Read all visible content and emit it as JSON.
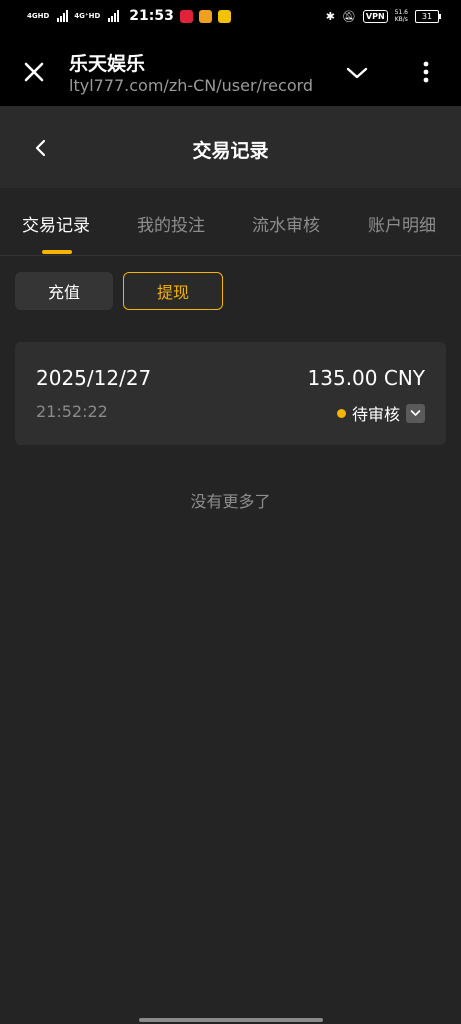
{
  "status_bar": {
    "network_1": "4GHD",
    "network_2": "4G⁺HD",
    "time": "21:53",
    "vpn": "VPN",
    "speed_value": "51.6",
    "speed_unit": "KB/s",
    "battery": "31",
    "app_icon_colors": [
      "#e0233a",
      "#f0a020",
      "#f2c200"
    ]
  },
  "browser": {
    "title": "乐天娱乐",
    "url": "ltyl777.com/zh-CN/user/record",
    "close_icon": "close-icon",
    "menu_icon": "kebab-menu-icon"
  },
  "header": {
    "title": "交易记录",
    "back_icon": "chevron-left-icon"
  },
  "tabs": [
    {
      "label": "交易记录",
      "active": true
    },
    {
      "label": "我的投注",
      "active": false
    },
    {
      "label": "流水审核",
      "active": false
    },
    {
      "label": "账户明细",
      "active": false
    }
  ],
  "filters": {
    "deposit": "充值",
    "withdraw": "提现",
    "selected": "提现"
  },
  "records": [
    {
      "date": "2025/12/27",
      "time": "21:52:22",
      "amount": "135.00 CNY",
      "status": "待审核",
      "status_color": "#f5b400"
    }
  ],
  "no_more_text": "没有更多了",
  "colors": {
    "accent": "#f5b400",
    "background": "#242424",
    "card": "#2f2f2f"
  }
}
